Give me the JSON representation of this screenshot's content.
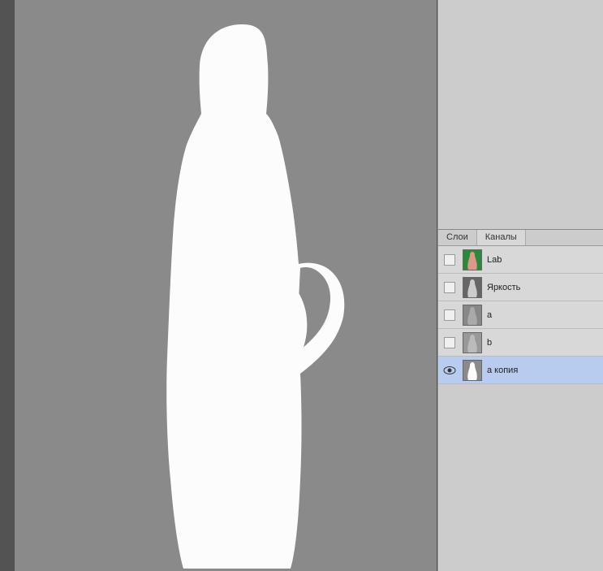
{
  "tabs": {
    "layers": "Слои",
    "channels": "Каналы"
  },
  "channels": [
    {
      "name": "Lab",
      "visible": false,
      "selected": false,
      "thumb": "lab"
    },
    {
      "name": "Яркость",
      "visible": false,
      "selected": false,
      "thumb": "lightness"
    },
    {
      "name": "a",
      "visible": false,
      "selected": false,
      "thumb": "a"
    },
    {
      "name": "b",
      "visible": false,
      "selected": false,
      "thumb": "b"
    },
    {
      "name": "a копия",
      "visible": true,
      "selected": true,
      "thumb": "acopy"
    }
  ]
}
